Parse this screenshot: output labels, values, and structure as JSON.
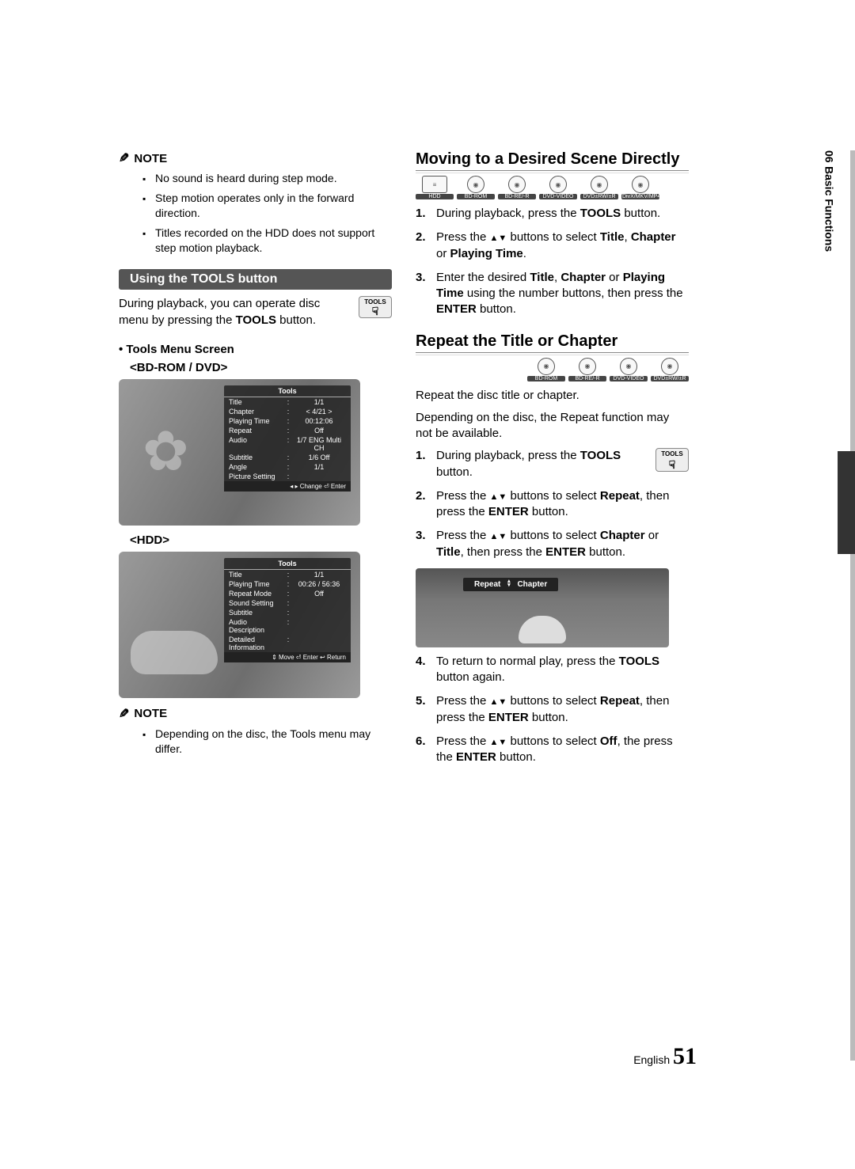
{
  "side": {
    "chapter_num": "06",
    "chapter_title": "Basic Functions"
  },
  "left": {
    "note1_label": "NOTE",
    "note1_items": [
      "No sound is heard during step mode.",
      "Step motion operates only in the forward direction.",
      "Titles recorded on the HDD does not support step motion playback."
    ],
    "tools_bar": "Using the TOOLS button",
    "tools_intro_a": "During playback, you can operate disc menu by pressing the ",
    "tools_intro_b": "TOOLS",
    "tools_intro_c": " button.",
    "tools_chip": "TOOLS",
    "bullet_tools_menu": "Tools Menu Screen",
    "label_bdrom": "<BD-ROM / DVD>",
    "mock1": {
      "title": "Tools",
      "rows": [
        {
          "k": "Title",
          "v": "1/1"
        },
        {
          "k": "Chapter",
          "v": "4/21",
          "nav": true
        },
        {
          "k": "Playing Time",
          "v": "00:12:06"
        },
        {
          "k": "Repeat",
          "v": "Off"
        },
        {
          "k": "Audio",
          "v": "1/7 ENG Multi CH"
        },
        {
          "k": "Subtitle",
          "v": "1/6 Off"
        },
        {
          "k": "Angle",
          "v": "1/1"
        },
        {
          "k": "Picture Setting",
          "v": ""
        }
      ],
      "foot": "◂ ▸ Change    ⏎ Enter"
    },
    "label_hdd": "<HDD>",
    "mock2": {
      "title": "Tools",
      "rows": [
        {
          "k": "Title",
          "v": "1/1"
        },
        {
          "k": "Playing Time",
          "v": "00:26 / 56:36"
        },
        {
          "k": "Repeat Mode",
          "v": "Off"
        },
        {
          "k": "Sound Setting",
          "v": ""
        },
        {
          "k": "Subtitle",
          "v": ""
        },
        {
          "k": "Audio Description",
          "v": ""
        },
        {
          "k": "Detailed Information",
          "v": ""
        }
      ],
      "foot": "⇕ Move   ⏎ Enter   ↩ Return"
    },
    "note2_label": "NOTE",
    "note2_items": [
      "Depending on the disc, the Tools menu may differ."
    ]
  },
  "right": {
    "h1": "Moving to a Desired Scene Directly",
    "discs1": [
      "HDD",
      "BD-ROM",
      "BD-RE/-R",
      "DVD-VIDEO",
      "DVD±RW/±R",
      "DivX/MKV/MP4"
    ],
    "steps1": [
      {
        "pre": "During playback, press the ",
        "b": "TOOLS",
        "post": " button."
      },
      {
        "pre": "Press the ",
        "arrows": true,
        "mid": " buttons to select ",
        "b": "Title",
        "mid2": ", ",
        "b2": "Chapter",
        "mid3": " or ",
        "b3": "Playing Time",
        "post": "."
      },
      {
        "pre": "Enter the desired ",
        "b": "Title",
        "mid": ", ",
        "b2": "Chapter",
        "mid2": " or ",
        "b3": "Playing Time",
        "mid3": " using the number buttons, then press the ",
        "b4": "ENTER",
        "post": " button."
      }
    ],
    "h2": "Repeat the Title or Chapter",
    "discs2": [
      "BD-ROM",
      "BD-RE/-R",
      "DVD-VIDEO",
      "DVD±RW/±R"
    ],
    "repeat_intro1": "Repeat the disc title or chapter.",
    "repeat_intro2": "Depending on the disc, the Repeat function may not be available.",
    "steps2_1": {
      "pre": "During playback, press the ",
      "b": "TOOLS",
      "post": " button."
    },
    "tools_chip2": "TOOLS",
    "steps2_2": {
      "pre": "Press the ",
      "arrows": true,
      "mid": " buttons to select ",
      "b": "Repeat",
      "mid2": ", then press the ",
      "b2": "ENTER",
      "post": " button."
    },
    "steps2_3": {
      "pre": "Press the ",
      "arrows": true,
      "mid": " buttons to select ",
      "b": "Chapter",
      "mid2": " or ",
      "b2": "Title",
      "mid3": ", then press the ",
      "b3": "ENTER",
      "post": " button."
    },
    "repeat_mock": {
      "label": "Repeat",
      "value": "Chapter"
    },
    "steps2_4": {
      "pre": "To return to normal play, press the ",
      "b": "TOOLS",
      "post": " button again."
    },
    "steps2_5": {
      "pre": "Press the ",
      "arrows": true,
      "mid": " buttons to select ",
      "b": "Repeat",
      "mid2": ", then press the ",
      "b2": "ENTER",
      "post": " button."
    },
    "steps2_6": {
      "pre": "Press the ",
      "arrows": true,
      "mid": " buttons to select ",
      "b": "Off",
      "mid2": ", the press the ",
      "b2": "ENTER",
      "post": " button."
    }
  },
  "footer": {
    "lang": "English",
    "page": "51"
  }
}
